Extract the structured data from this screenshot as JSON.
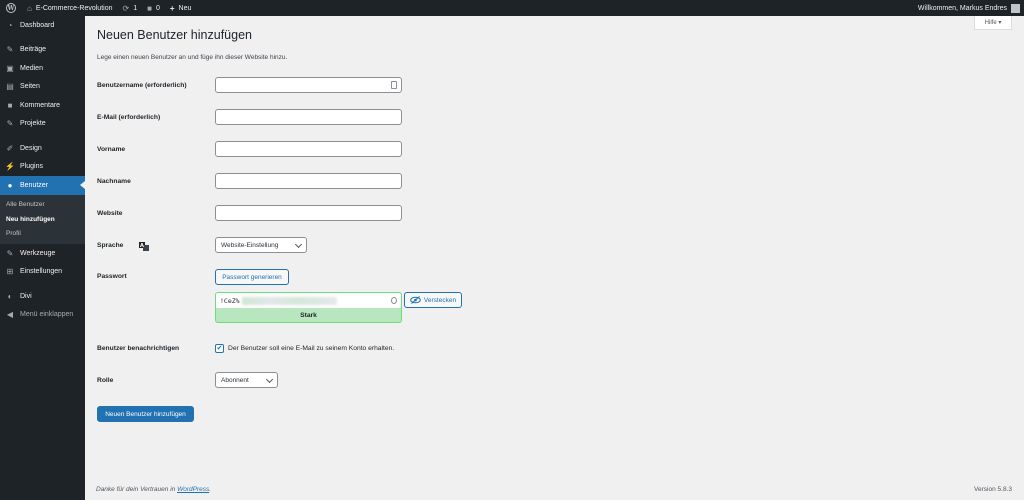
{
  "adminbar": {
    "site_name": "E-Commerce-Revolution",
    "updates_count": "1",
    "comments_count": "0",
    "new_label": "Neu",
    "greeting": "Willkommen, Markus Endres"
  },
  "sidebar": {
    "items": [
      {
        "label": "Dashboard",
        "icon": "dashboard-icon"
      },
      {
        "label": "Beiträge",
        "icon": "pin-icon"
      },
      {
        "label": "Medien",
        "icon": "media-icon"
      },
      {
        "label": "Seiten",
        "icon": "page-icon"
      },
      {
        "label": "Kommentare",
        "icon": "comment-icon"
      },
      {
        "label": "Projekte",
        "icon": "pin-icon"
      },
      {
        "label": "Design",
        "icon": "brush-icon"
      },
      {
        "label": "Plugins",
        "icon": "plugin-icon"
      },
      {
        "label": "Benutzer",
        "icon": "user-icon"
      },
      {
        "label": "Werkzeuge",
        "icon": "wrench-icon"
      },
      {
        "label": "Einstellungen",
        "icon": "settings-icon"
      },
      {
        "label": "Divi",
        "icon": "divi-icon"
      },
      {
        "label": "Menü einklappen",
        "icon": "collapse-icon"
      }
    ],
    "submenu": [
      "Alle Benutzer",
      "Neu hinzufügen",
      "Profil"
    ]
  },
  "help_label": "Hilfe ▾",
  "page": {
    "title": "Neuen Benutzer hinzufügen",
    "intro": "Lege einen neuen Benutzer an und füge ihn dieser Website hinzu."
  },
  "form": {
    "username_label": "Benutzername (erforderlich)",
    "email_label": "E-Mail (erforderlich)",
    "firstname_label": "Vorname",
    "lastname_label": "Nachname",
    "website_label": "Website",
    "language_label": "Sprache",
    "language_value": "Website-Einstellung",
    "password_label": "Passwort",
    "generate_password": "Passwort generieren",
    "password_visible": "!CeZ%",
    "strength": "Stark",
    "hide_label": "Verstecken",
    "notify_label": "Benutzer benachrichtigen",
    "notify_text": "Der Benutzer soll eine E-Mail zu seinem Konto erhalten.",
    "role_label": "Rolle",
    "role_value": "Abonnent",
    "submit": "Neuen Benutzer hinzufügen"
  },
  "footer": {
    "thanks_prefix": "Danke für dein Vertrauen in ",
    "thanks_link": "WordPress",
    "thanks_suffix": ".",
    "version": "Version 5.8.3"
  },
  "colors": {
    "accent": "#2271b1",
    "sidebar": "#1d2327",
    "strength_bg": "#b8e6bf"
  }
}
